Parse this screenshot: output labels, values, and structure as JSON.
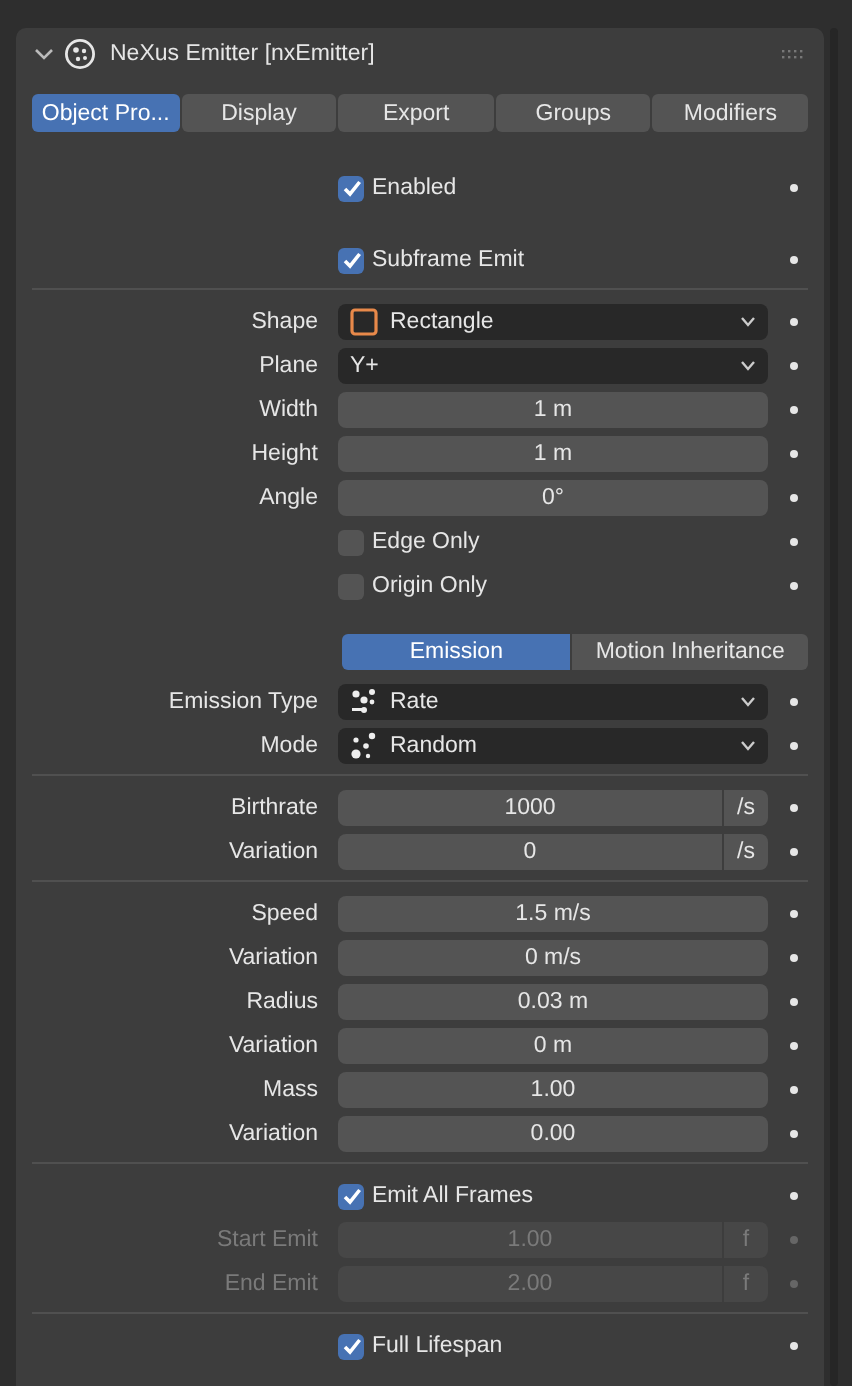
{
  "panel": {
    "title": "NeXus Emitter [nxEmitter]",
    "expanded": true
  },
  "tabs": [
    {
      "label": "Object Pro...",
      "selected": true
    },
    {
      "label": "Display",
      "selected": false
    },
    {
      "label": "Export",
      "selected": false
    },
    {
      "label": "Groups",
      "selected": false
    },
    {
      "label": "Modifiers",
      "selected": false
    }
  ],
  "sections": [
    {
      "rows": [
        {
          "kind": "checkbox",
          "label": "Enabled",
          "checked": true
        },
        {
          "kind": "checkbox",
          "label": "Subframe Emit",
          "checked": true
        }
      ]
    },
    {
      "rows": [
        {
          "kind": "dropdown",
          "label": "Shape",
          "value": "Rectangle"
        },
        {
          "kind": "dropdown",
          "label": "Plane",
          "value": "Y+"
        },
        {
          "kind": "number",
          "label": "Width",
          "value": "1 m"
        },
        {
          "kind": "number",
          "label": "Height",
          "value": "1 m"
        },
        {
          "kind": "number",
          "label": "Angle",
          "value": "0°"
        },
        {
          "kind": "checkbox",
          "label": "Edge Only",
          "checked": false
        },
        {
          "kind": "checkbox",
          "label": "Origin Only",
          "checked": false
        },
        {
          "kind": "subtabs",
          "tabs": [
            {
              "label": "Emission",
              "selected": true
            },
            {
              "label": "Motion Inheritance",
              "selected": false
            }
          ]
        },
        {
          "kind": "dropdown",
          "label": "Emission Type",
          "value": "Rate"
        },
        {
          "kind": "dropdown",
          "label": "Mode",
          "value": "Random"
        }
      ]
    },
    {
      "rows": [
        {
          "kind": "number",
          "label": "Birthrate",
          "value": "1000",
          "unit": "/s"
        },
        {
          "kind": "number",
          "label": "Variation",
          "value": "0",
          "unit": "/s"
        }
      ]
    },
    {
      "rows": [
        {
          "kind": "number",
          "label": "Speed",
          "value": "1.5 m/s"
        },
        {
          "kind": "number",
          "label": "Variation",
          "value": "0 m/s"
        },
        {
          "kind": "number",
          "label": "Radius",
          "value": "0.03 m"
        },
        {
          "kind": "number",
          "label": "Variation",
          "value": "0 m"
        },
        {
          "kind": "number",
          "label": "Mass",
          "value": "1.00"
        },
        {
          "kind": "number",
          "label": "Variation",
          "value": "0.00"
        }
      ]
    },
    {
      "rows": [
        {
          "kind": "checkbox",
          "label": "Emit All Frames",
          "checked": true
        },
        {
          "kind": "number",
          "label": "Start Emit",
          "value": "1.00",
          "unit": "f",
          "disabled": true
        },
        {
          "kind": "number",
          "label": "End Emit",
          "value": "2.00",
          "unit": "f",
          "disabled": true
        }
      ]
    },
    {
      "rows": [
        {
          "kind": "checkbox",
          "label": "Full Lifespan",
          "checked": true
        }
      ]
    }
  ]
}
